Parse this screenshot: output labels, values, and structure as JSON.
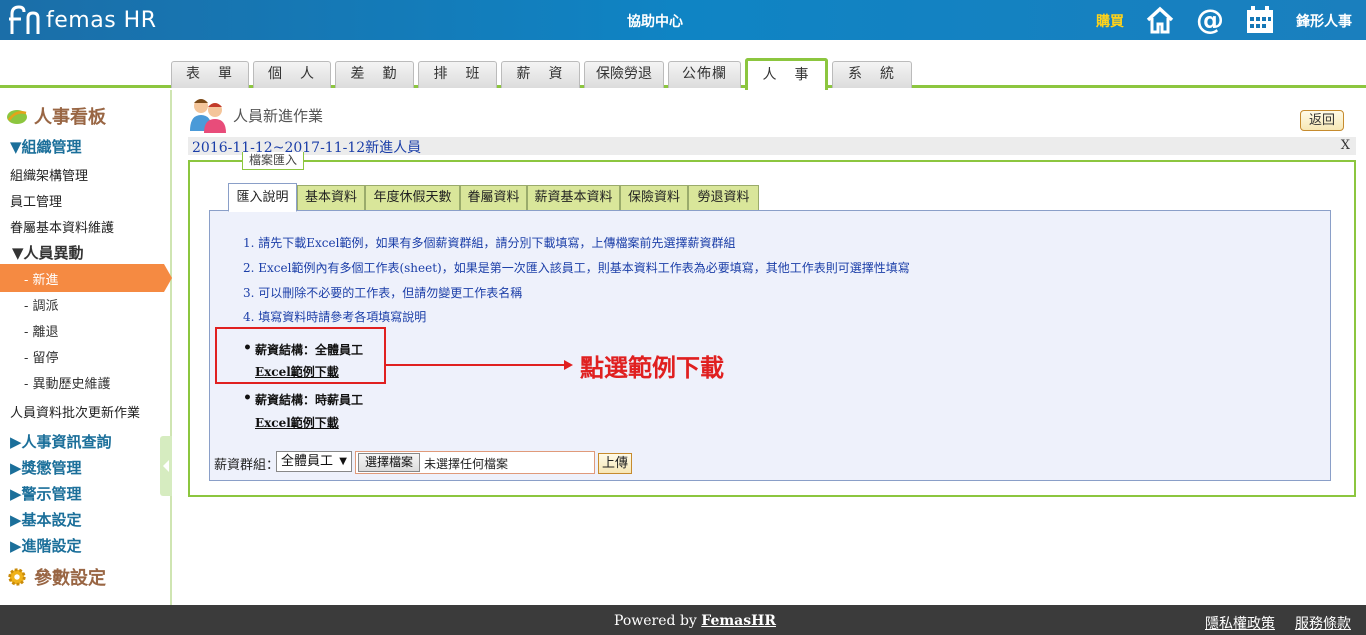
{
  "header": {
    "logo_text": "femas HR",
    "help_center": "協助中心",
    "buy": "購買",
    "company": "鋒形人事"
  },
  "main_tabs": [
    "表　單",
    "個　人",
    "差　勤",
    "排　班",
    "薪　資",
    "保險勞退",
    "公佈欄",
    "人　事",
    "系　統"
  ],
  "active_main_tab": "人　事",
  "sidebar": {
    "board": "人事看板",
    "org_mgmt": "▼組織管理",
    "org_structure": "組織架構管理",
    "employee_mgmt": "員工管理",
    "family_maint": "眷屬基本資料維護",
    "personnel_change": "▼人員異動",
    "new_hire": "- 新進",
    "transfer": "- 調派",
    "resign": "- 離退",
    "suspend": "- 留停",
    "history": "- 異動歷史維護",
    "batch_update": "人員資料批次更新作業",
    "hr_query": "▶人事資訊查詢",
    "reward": "▶獎懲管理",
    "warning": "▶警示管理",
    "basic_settings": "▶基本設定",
    "advanced_settings": "▶進階設定",
    "param_settings": "參數設定"
  },
  "page": {
    "title": "人員新進作業",
    "back": "返回",
    "range": "2016-11-12~2017-11-12新進人員",
    "close": "X",
    "legend": "檔案匯入"
  },
  "sub_tabs": [
    "匯入說明",
    "基本資料",
    "年度休假天數",
    "眷屬資料",
    "薪資基本資料",
    "保險資料",
    "勞退資料"
  ],
  "instructions": {
    "step1": "1.  請先下載Excel範例，如果有多個薪資群組，請分別下載填寫，上傳檔案前先選擇薪資群組",
    "step2": "2.  Excel範例內有多個工作表(sheet)，如果是第一次匯入該員工，則基本資料工作表為必要填寫，其他工作表則可選擇性填寫",
    "step3": "3.  可以刪除不必要的工作表，但請勿變更工作表名稱",
    "step4": "4.  填寫資料時請參考各項填寫說明",
    "group1": "薪資結構：全體員工",
    "group1_link": "Excel範例下載",
    "group2": "薪資結構：時薪員工",
    "group2_link": "Excel範例下載",
    "annotation": "點選範例下載"
  },
  "upload": {
    "label": "薪資群組：",
    "select_value": "全體員工",
    "choose_file": "選擇檔案",
    "no_file": "未選擇任何檔案",
    "upload_btn": "上傳"
  },
  "footer": {
    "powered_prefix": "Powered by",
    "powered_link": "FemasHR",
    "privacy": "隱私權政策",
    "terms": "服務條款"
  },
  "colors": {
    "header_blue": "#0f84c4",
    "accent_green": "#8cc63f",
    "active_orange": "#f58a42",
    "annotation_red": "#e02020"
  }
}
